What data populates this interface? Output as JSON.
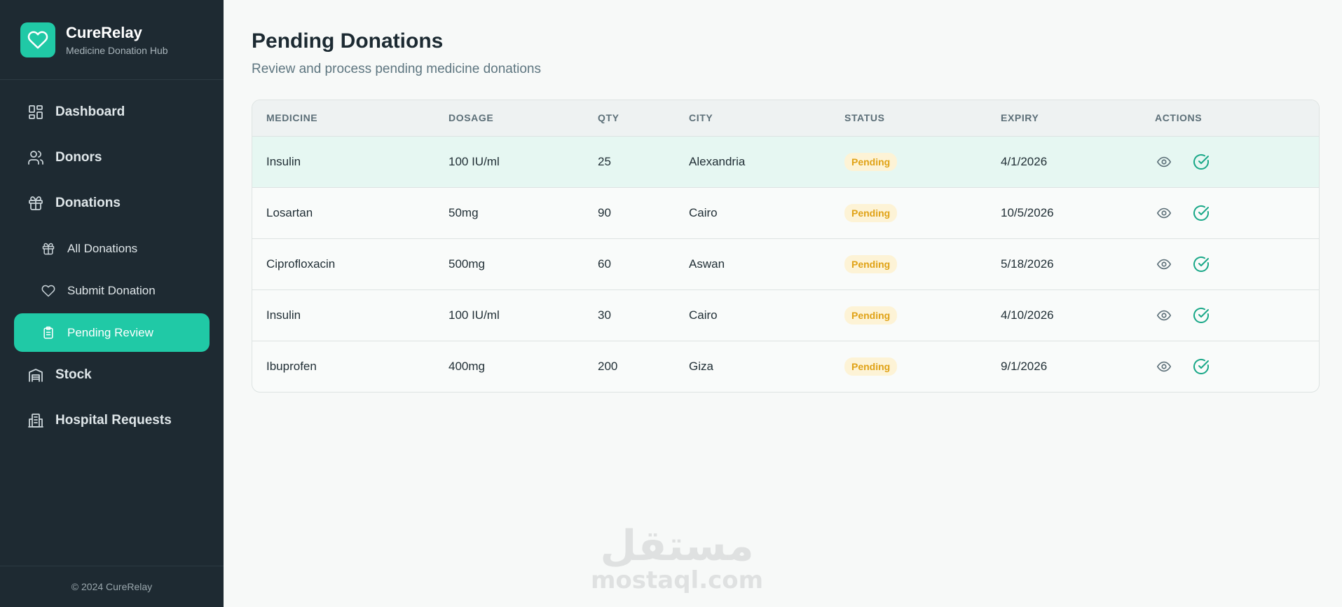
{
  "brand": {
    "name": "CureRelay",
    "tagline": "Medicine Donation Hub"
  },
  "sidebar": {
    "items": [
      {
        "label": "Dashboard",
        "icon": "dashboard-icon"
      },
      {
        "label": "Donors",
        "icon": "users-icon"
      },
      {
        "label": "Donations",
        "icon": "gift-icon"
      },
      {
        "label": "All Donations",
        "icon": "gift-icon"
      },
      {
        "label": "Submit Donation",
        "icon": "heart-icon"
      },
      {
        "label": "Pending Review",
        "icon": "clipboard-icon",
        "active": true
      },
      {
        "label": "Stock",
        "icon": "warehouse-icon"
      },
      {
        "label": "Hospital Requests",
        "icon": "hospital-icon"
      }
    ],
    "footer": "© 2024 CureRelay"
  },
  "page": {
    "title": "Pending Donations",
    "subtitle": "Review and process pending medicine donations"
  },
  "table": {
    "headers": [
      "MEDICINE",
      "DOSAGE",
      "QTY",
      "CITY",
      "STATUS",
      "EXPIRY",
      "ACTIONS"
    ],
    "rows": [
      {
        "medicine": "Insulin",
        "dosage": "100 IU/ml",
        "qty": "25",
        "city": "Alexandria",
        "status": "Pending",
        "expiry": "4/1/2026"
      },
      {
        "medicine": "Losartan",
        "dosage": "50mg",
        "qty": "90",
        "city": "Cairo",
        "status": "Pending",
        "expiry": "10/5/2026"
      },
      {
        "medicine": "Ciprofloxacin",
        "dosage": "500mg",
        "qty": "60",
        "city": "Aswan",
        "status": "Pending",
        "expiry": "5/18/2026"
      },
      {
        "medicine": "Insulin",
        "dosage": "100 IU/ml",
        "qty": "30",
        "city": "Cairo",
        "status": "Pending",
        "expiry": "4/10/2026"
      },
      {
        "medicine": "Ibuprofen",
        "dosage": "400mg",
        "qty": "200",
        "city": "Giza",
        "status": "Pending",
        "expiry": "9/1/2026"
      }
    ],
    "action_icons": [
      "eye-icon",
      "check-circle-icon"
    ]
  },
  "watermark": {
    "arabic": "مستقل",
    "latin": "mostaql.com"
  },
  "colors": {
    "sidebar_bg": "#1e2a32",
    "accent": "#20c9a6",
    "badge_bg": "#fdf3d6",
    "badge_text": "#e0a216",
    "highlight_row": "#e6f7f2"
  }
}
